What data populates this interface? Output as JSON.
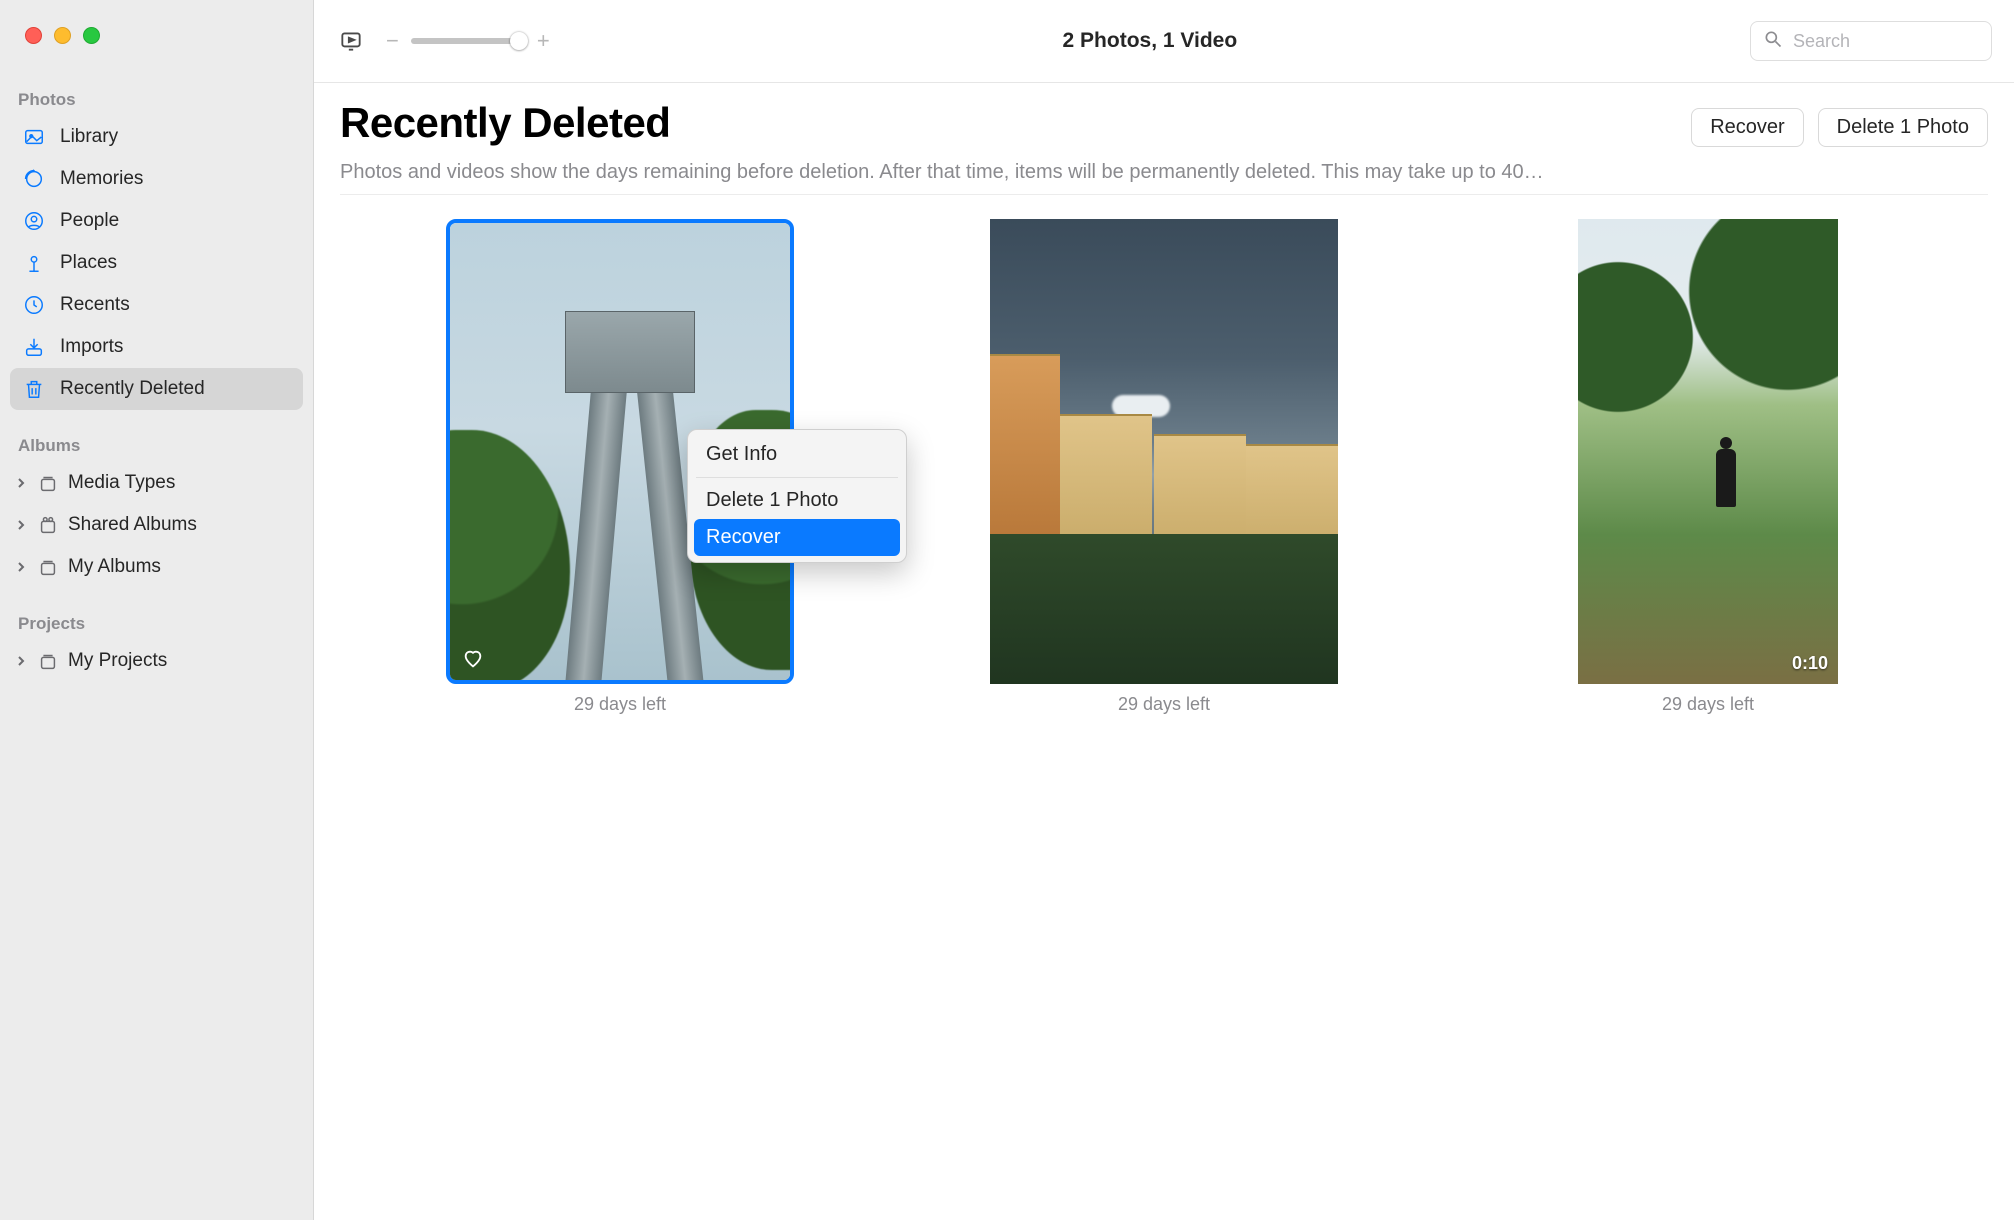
{
  "toolbar": {
    "title": "2 Photos, 1 Video",
    "search_placeholder": "Search"
  },
  "header": {
    "title": "Recently Deleted",
    "recover_btn": "Recover",
    "delete_btn": "Delete 1 Photo",
    "description": "Photos and videos show the days remaining before deletion. After that time, items will be permanently deleted. This may take up to 40…"
  },
  "sidebar": {
    "section_photos": "Photos",
    "section_albums": "Albums",
    "section_projects": "Projects",
    "items": [
      {
        "label": "Library",
        "icon": "photo-library-icon"
      },
      {
        "label": "Memories",
        "icon": "memories-icon"
      },
      {
        "label": "People",
        "icon": "people-icon"
      },
      {
        "label": "Places",
        "icon": "places-icon"
      },
      {
        "label": "Recents",
        "icon": "clock-icon"
      },
      {
        "label": "Imports",
        "icon": "import-icon"
      },
      {
        "label": "Recently Deleted",
        "icon": "trash-icon"
      }
    ],
    "albums": [
      {
        "label": "Media Types"
      },
      {
        "label": "Shared Albums"
      },
      {
        "label": "My Albums"
      }
    ],
    "projects": [
      {
        "label": "My Projects"
      }
    ]
  },
  "grid": [
    {
      "caption": "29 days left",
      "favorite": true,
      "selected": true
    },
    {
      "caption": "29 days left"
    },
    {
      "caption": "29 days left",
      "duration": "0:10"
    }
  ],
  "context_menu": {
    "get_info": "Get Info",
    "delete": "Delete 1 Photo",
    "recover": "Recover"
  }
}
